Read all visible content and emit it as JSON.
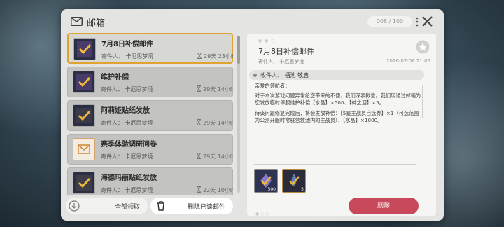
{
  "header": {
    "title": "邮箱",
    "count": "008 / 100",
    "icons": {
      "mail": "mail-icon",
      "more": "more-vertical-icon",
      "close": "close-icon"
    }
  },
  "mail_list": [
    {
      "title": "7月8日补偿邮件",
      "sender": "寄件人： 卡厄思梦境",
      "time": "29天 23小时",
      "selected": true,
      "thumb": "reward-check-icon"
    },
    {
      "title": "维护补偿",
      "sender": "寄件人： 卡厄思梦境",
      "time": "29天 14小时",
      "selected": false,
      "thumb": "reward-check-icon"
    },
    {
      "title": "阿莉娅贴纸发放",
      "sender": "寄件人： 卡厄思梦境",
      "time": "29天 14小时",
      "selected": false,
      "thumb": "reward-check-icon"
    },
    {
      "title": "赛季体验调研问卷",
      "sender": "寄件人： 卡厄思梦境",
      "time": "29天 14小时",
      "selected": false,
      "thumb": "envelope-icon"
    },
    {
      "title": "海德玛丽贴纸发放",
      "sender": "寄件人： 卡厄思梦境",
      "time": "22天 10小时",
      "selected": false,
      "thumb": "reward-check-icon"
    }
  ],
  "actions": {
    "claim_all": "全部领取",
    "delete_read": "删除已读邮件",
    "delete": "删除"
  },
  "detail": {
    "title": "7月8日补偿邮件",
    "sender": "寄件人： 卡厄思梦境",
    "date": "2026-07-08 21:05",
    "recipient": "收件人：  栖池 敬启",
    "greeting": "亲爱的领航者：",
    "para1": "对于本次游戏问题异常给您带来的不便，我们深表歉意。我们现通过邮箱为您发放临时停服维护补偿【水晶】×500、【神之泪】×5。",
    "para2": "待该问题修复完成后，将会发放补偿：【5星主战员自选券】×1（可选范围为公测开服时常驻营救池内的主战员）、【水晶】×1000。",
    "attachments": [
      {
        "icon": "crystal-reward-icon",
        "count": "500"
      },
      {
        "icon": "tear-reward-icon",
        "count": "5"
      }
    ]
  },
  "colors": {
    "accent": "#e0a230",
    "delete": "#c84a5a",
    "panel": "#e4e4e2"
  }
}
